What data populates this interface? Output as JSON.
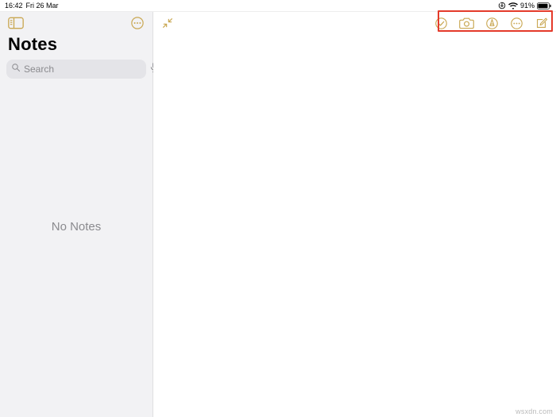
{
  "status": {
    "time": "16:42",
    "date": "Fri 26 Mar",
    "battery_pct": "91%"
  },
  "sidebar": {
    "title": "Notes",
    "search_placeholder": "Search",
    "empty_label": "No Notes"
  },
  "colors": {
    "accent": "#c9a752",
    "highlight": "#e43a2a"
  },
  "watermark": "wsxdn.com"
}
